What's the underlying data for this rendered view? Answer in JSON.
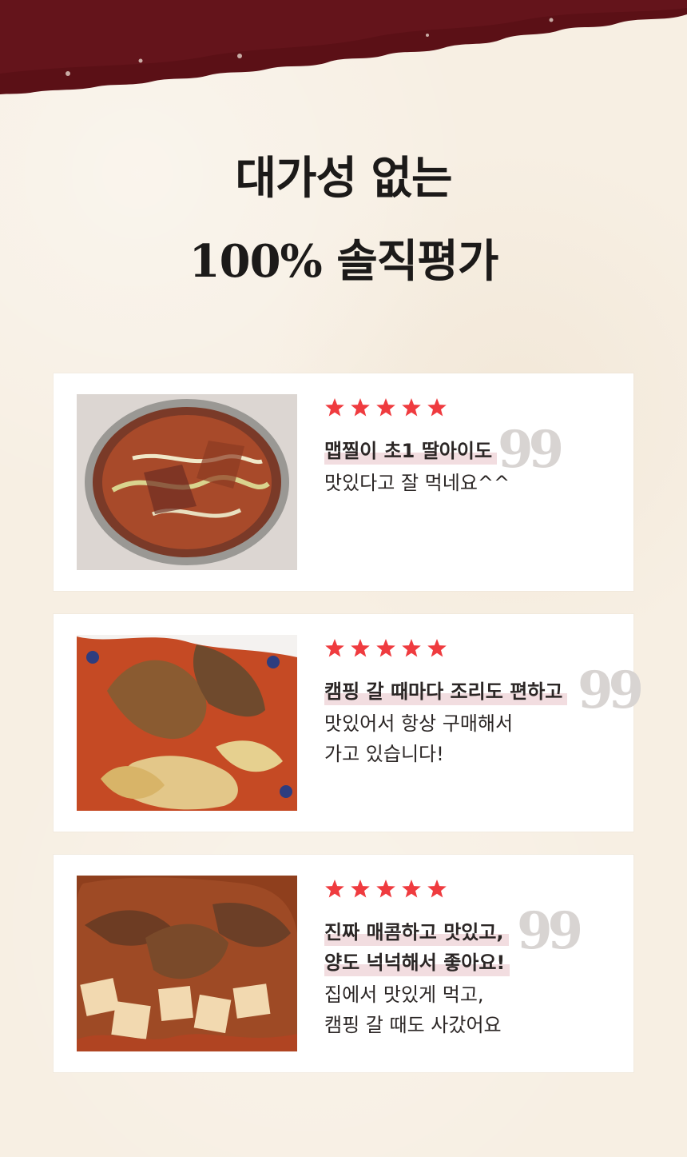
{
  "page": {
    "title_line1": "대가성 없는",
    "title_line2": "100% 솔직평가"
  },
  "colors": {
    "brush": "#5b1016",
    "star": "#ef3b3f",
    "highlight": "#f2dde0",
    "quote": "#d8d4d2",
    "text": "#2b2625"
  },
  "reviews": [
    {
      "rating": 5,
      "photo_label": "",
      "headline_1": "맵찔이 초1 딸아이도",
      "headline_2": "",
      "desc_1": "맛있다고 잘 먹네요^^",
      "desc_2": ""
    },
    {
      "rating": 5,
      "photo_label": "",
      "headline_1": "캠핑 갈 때마다 조리도 편하고",
      "headline_2": "",
      "desc_1": "맛있어서 항상 구매해서",
      "desc_2": "가고 있습니다!"
    },
    {
      "rating": 5,
      "photo_label": "",
      "headline_1": "진짜 매콤하고 맛있고,",
      "headline_2": "양도 넉넉해서 좋아요!",
      "desc_1": "집에서 맛있게 먹고,",
      "desc_2": "캠핑 갈 때도 사갔어요"
    }
  ],
  "quote_mark": "99",
  "icons": [
    "star-icon",
    "quote-icon"
  ]
}
